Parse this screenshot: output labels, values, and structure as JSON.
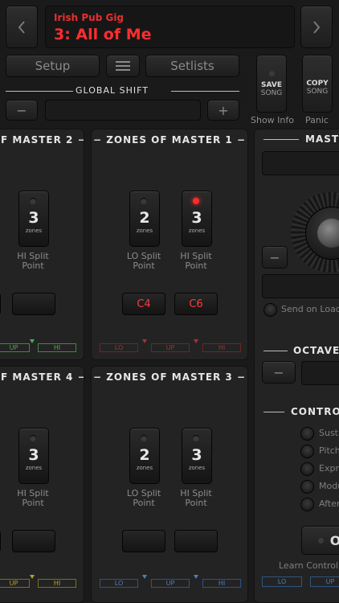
{
  "header": {
    "subtitle": "Irish Pub Gig",
    "song": "3: All of Me",
    "prev_icon": "chevron-left",
    "next_icon": "chevron-right"
  },
  "toolbar": {
    "setup": "Setup",
    "menu_icon": "hamburger-menu",
    "setlists": "Setlists",
    "save_top": "SAVE",
    "save_bottom": "SONG",
    "copy_top": "COPY",
    "copy_bottom": "SONG",
    "show_info": "Show Info",
    "panic": "Panic"
  },
  "global_shift": {
    "title": "GLOBAL SHIFT",
    "minus": "−",
    "plus": "+"
  },
  "panels": {
    "m2": {
      "title": "F MASTER 2",
      "switches": [
        {
          "num": "3",
          "zones": "zones",
          "label1": "HI Split",
          "label2": "Point"
        }
      ],
      "tags": [
        "UP",
        "HI"
      ]
    },
    "m1": {
      "title": "ZONES OF MASTER 1",
      "switches": [
        {
          "num": "2",
          "zones": "zones",
          "label1": "LO Split",
          "label2": "Point"
        },
        {
          "num": "3",
          "zones": "zones",
          "label1": "HI Split",
          "label2": "Point"
        }
      ],
      "notes": [
        "C4",
        "C6"
      ],
      "tags": [
        "LO",
        "UP",
        "HI"
      ]
    },
    "m4": {
      "title": "F MASTER 4",
      "switches": [
        {
          "num": "3",
          "zones": "zones",
          "label1": "HI Split",
          "label2": "Point"
        }
      ],
      "tags": [
        "UP",
        "HI"
      ]
    },
    "m3": {
      "title": "ZONES OF MASTER 3",
      "switches": [
        {
          "num": "2",
          "zones": "zones",
          "label1": "LO Split",
          "label2": "Point"
        },
        {
          "num": "3",
          "zones": "zones",
          "label1": "HI Split",
          "label2": "Point"
        }
      ],
      "tags": [
        "LO",
        "UP",
        "HI"
      ]
    }
  },
  "right": {
    "master_title": "MASTE",
    "minus": "−",
    "send_on_load": "Send on Load",
    "octave_title": "OCTAVE",
    "octave_minus": "−",
    "controls_title": "CONTRO",
    "controls": [
      "Susta",
      "Pitch",
      "Expre",
      "Modu",
      "After"
    ],
    "learn_button": "O",
    "learn_label": "Learn Controll",
    "bottom_tags": [
      "LO",
      "UP"
    ]
  },
  "colors": {
    "accent_red": "#ff2a2a",
    "tag_green": "#4caf50",
    "tag_red": "#a83232",
    "tag_yellow": "#b5a32a",
    "tag_blue": "#4a7fc1"
  }
}
